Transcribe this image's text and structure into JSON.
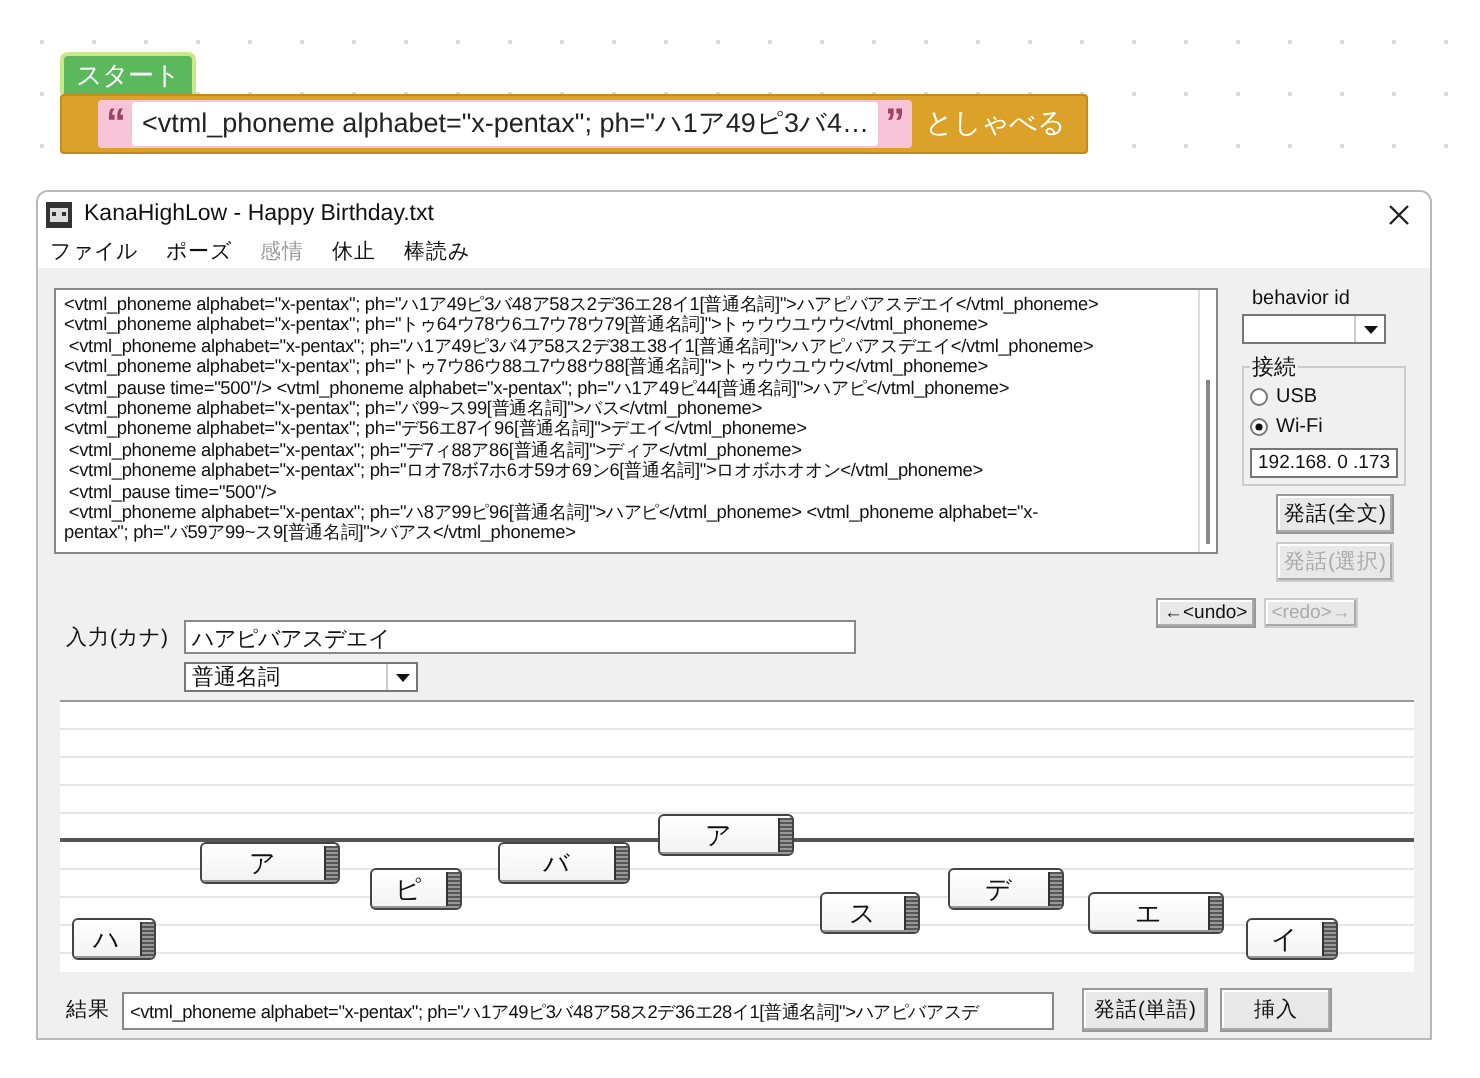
{
  "blockly": {
    "start_label": "スタート",
    "quote_open": "“",
    "text": "<vtml_phoneme alphabet=\"x-pentax\"; ph=\"ハ1ア49ピ3バ4…",
    "quote_close": "”",
    "suffix": "としゃべる"
  },
  "window": {
    "title": "KanaHighLow - Happy Birthday.txt"
  },
  "menu": [
    {
      "label": "ファイル",
      "disabled": false
    },
    {
      "label": "ポーズ",
      "disabled": false
    },
    {
      "label": "感情",
      "disabled": true
    },
    {
      "label": "休止",
      "disabled": false
    },
    {
      "label": "棒読み",
      "disabled": false
    }
  ],
  "script_lines": [
    "<vtml_phoneme alphabet=\"x-pentax\"; ph=\"ハ1ア49ピ3バ48ア58ス2デ36エ28イ1[普通名詞]\">ハアピバアスデエイ</vtml_phoneme>",
    "<vtml_phoneme alphabet=\"x-pentax\"; ph=\"トゥ64ウ78ウ6ユ7ウ78ウ79[普通名詞]\">トゥウウユウウ</vtml_phoneme>",
    " <vtml_phoneme alphabet=\"x-pentax\"; ph=\"ハ1ア49ピ3バ4ア58ス2デ38エ38イ1[普通名詞]\">ハアピバアスデエイ</vtml_phoneme>",
    "<vtml_phoneme alphabet=\"x-pentax\"; ph=\"トゥ7ウ86ウ88ユ7ウ88ウ88[普通名詞]\">トゥウウユウウ</vtml_phoneme>",
    "<vtml_pause time=\"500\"/> <vtml_phoneme alphabet=\"x-pentax\"; ph=\"ハ1ア49ピ44[普通名詞]\">ハアピ</vtml_phoneme>",
    "<vtml_phoneme alphabet=\"x-pentax\"; ph=\"バ99~ス99[普通名詞]\">バス</vtml_phoneme>",
    "<vtml_phoneme alphabet=\"x-pentax\"; ph=\"デ56エ87イ96[普通名詞]\">デエイ</vtml_phoneme>",
    " <vtml_phoneme alphabet=\"x-pentax\"; ph=\"デ7ィ88ア86[普通名詞]\">ディア</vtml_phoneme>",
    " <vtml_phoneme alphabet=\"x-pentax\"; ph=\"ロオ78ボ7ホ6オ59オ69ン6[普通名詞]\">ロオボホオオン</vtml_phoneme>",
    " <vtml_pause time=\"500\"/>",
    " <vtml_phoneme alphabet=\"x-pentax\"; ph=\"ハ8ア99ピ96[普通名詞]\">ハアピ</vtml_phoneme> <vtml_phoneme alphabet=\"x-",
    "pentax\"; ph=\"バ59ア99~ス9[普通名詞]\">バアス</vtml_phoneme>"
  ],
  "behavior": {
    "label": "behavior id"
  },
  "connection": {
    "label": "接続",
    "options": [
      {
        "label": "USB",
        "selected": false
      },
      {
        "label": "Wi-Fi",
        "selected": true
      }
    ],
    "ip": "192.168. 0 .173"
  },
  "speak_buttons": [
    {
      "label": "発話(全文)",
      "disabled": false
    },
    {
      "label": "発話(選択)",
      "disabled": true
    }
  ],
  "history_buttons": [
    {
      "label": "←<undo>",
      "disabled": false
    },
    {
      "label": "<redo>→",
      "disabled": true
    }
  ],
  "input": {
    "label": "入力(カナ)",
    "value": "ハアピバアスデエイ",
    "category": "普通名詞"
  },
  "syllables": [
    {
      "kana": "ハ"
    },
    {
      "kana": "ア"
    },
    {
      "kana": "ピ"
    },
    {
      "kana": "バ"
    },
    {
      "kana": "ア"
    },
    {
      "kana": "ス"
    },
    {
      "kana": "デ"
    },
    {
      "kana": "エ"
    },
    {
      "kana": "イ"
    }
  ],
  "result": {
    "label": "結果",
    "value": "<vtml_phoneme alphabet=\"x-pentax\"; ph=\"ハ1ア49ピ3バ48ア58ス2デ36エ28イ1[普通名詞]\">ハアピバアスデ"
  },
  "bottom_buttons": [
    {
      "label": "発話(単語)"
    },
    {
      "label": "挿入"
    }
  ]
}
